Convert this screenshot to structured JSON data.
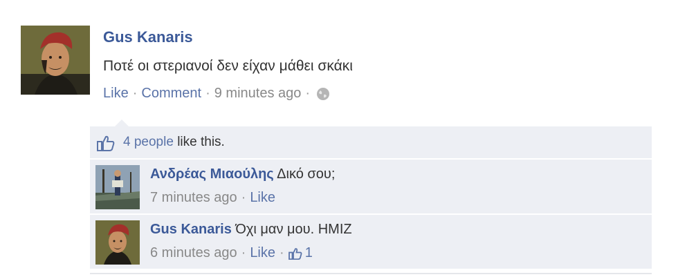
{
  "post": {
    "author": "Gus Kanaris",
    "text": "Ποτέ οι στεριανοί δεν είχαν μάθει σκάκι",
    "actions": {
      "like": "Like",
      "comment": "Comment",
      "time": "9 minutes ago"
    }
  },
  "likes": {
    "count_text": "4 people",
    "suffix": "like this."
  },
  "comments": [
    {
      "author": "Ανδρέας Μιαούλης",
      "text": "Δικό σου;",
      "time": "7 minutes ago",
      "like": "Like"
    },
    {
      "author": "Gus Kanaris",
      "text": "Όχι μαν μου. ΗΜΙΖ",
      "time": "6 minutes ago",
      "like": "Like",
      "like_count": "1"
    }
  ],
  "colors": {
    "link": "#3b5998",
    "panel": "#edeff4"
  },
  "icons": [
    "globe-icon",
    "thumbs-up-icon",
    "avatar"
  ]
}
